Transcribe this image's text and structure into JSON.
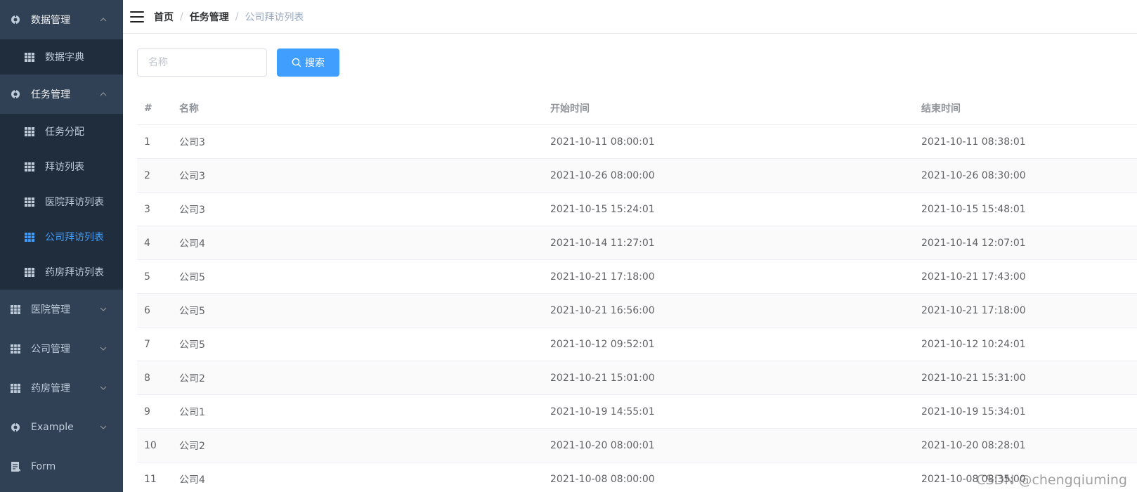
{
  "sidebar": {
    "groups": [
      {
        "label": "数据管理",
        "icon": "settings-icon",
        "expanded": true,
        "children": [
          {
            "label": "数据字典"
          }
        ]
      },
      {
        "label": "任务管理",
        "icon": "settings-icon",
        "expanded": true,
        "children": [
          {
            "label": "任务分配"
          },
          {
            "label": "拜访列表"
          },
          {
            "label": "医院拜访列表"
          },
          {
            "label": "公司拜访列表",
            "active": true
          },
          {
            "label": "药房拜访列表"
          }
        ]
      },
      {
        "label": "医院管理",
        "icon": "table-icon",
        "expanded": false
      },
      {
        "label": "公司管理",
        "icon": "table-icon",
        "expanded": false
      },
      {
        "label": "药房管理",
        "icon": "table-icon",
        "expanded": false
      },
      {
        "label": "Example",
        "icon": "settings-icon",
        "expanded": false
      },
      {
        "label": "Form",
        "icon": "form-icon",
        "expanded": false
      }
    ]
  },
  "breadcrumb": [
    "首页",
    "任务管理",
    "公司拜访列表"
  ],
  "search": {
    "placeholder": "名称",
    "value": "",
    "button_label": "搜索"
  },
  "table": {
    "headers": [
      "#",
      "名称",
      "开始时间",
      "结束时间"
    ],
    "rows": [
      [
        "1",
        "公司3",
        "2021-10-11 08:00:01",
        "2021-10-11 08:38:01"
      ],
      [
        "2",
        "公司3",
        "2021-10-26 08:00:00",
        "2021-10-26 08:30:00"
      ],
      [
        "3",
        "公司3",
        "2021-10-15 15:24:01",
        "2021-10-15 15:48:01"
      ],
      [
        "4",
        "公司4",
        "2021-10-14 11:27:01",
        "2021-10-14 12:07:01"
      ],
      [
        "5",
        "公司5",
        "2021-10-21 17:18:00",
        "2021-10-21 17:43:00"
      ],
      [
        "6",
        "公司5",
        "2021-10-21 16:56:00",
        "2021-10-21 17:18:00"
      ],
      [
        "7",
        "公司5",
        "2021-10-12 09:52:01",
        "2021-10-12 10:24:01"
      ],
      [
        "8",
        "公司2",
        "2021-10-21 15:01:00",
        "2021-10-21 15:31:00"
      ],
      [
        "9",
        "公司1",
        "2021-10-19 14:55:01",
        "2021-10-19 15:34:01"
      ],
      [
        "10",
        "公司2",
        "2021-10-20 08:00:01",
        "2021-10-20 08:28:01"
      ],
      [
        "11",
        "公司4",
        "2021-10-08 08:00:00",
        "2021-10-08 08:35:00"
      ]
    ]
  },
  "watermark": "CSDN @chengqiuming",
  "colors": {
    "sidebar_bg": "#304156",
    "submenu_bg": "#1f2d3d",
    "accent": "#409eff",
    "menu_text": "#bfcbd9"
  }
}
